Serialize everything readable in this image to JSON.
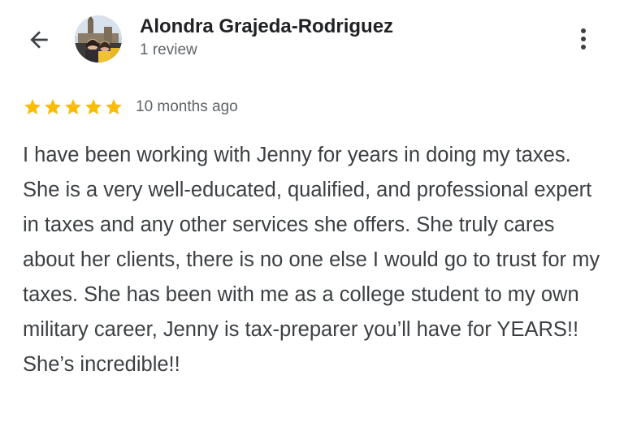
{
  "header": {
    "back_icon": "arrow-back-icon",
    "reviewer_name": "Alondra Grajeda-Rodriguez",
    "review_count": "1 review",
    "more_icon": "more-vert-icon"
  },
  "review": {
    "rating": 5,
    "rating_max": 5,
    "star_color": "#fbbc04",
    "time": "10 months ago",
    "text": "I have been working with Jenny for years in doing my taxes. She is a very well-educated, qualified, and professional expert in taxes and any other services she offers. She truly cares about her clients, there is no one else I would go to trust for my taxes. She has been with me as a college student to my own military career, Jenny is tax-preparer you’ll have for YEARS!! She’s incredible!!"
  }
}
